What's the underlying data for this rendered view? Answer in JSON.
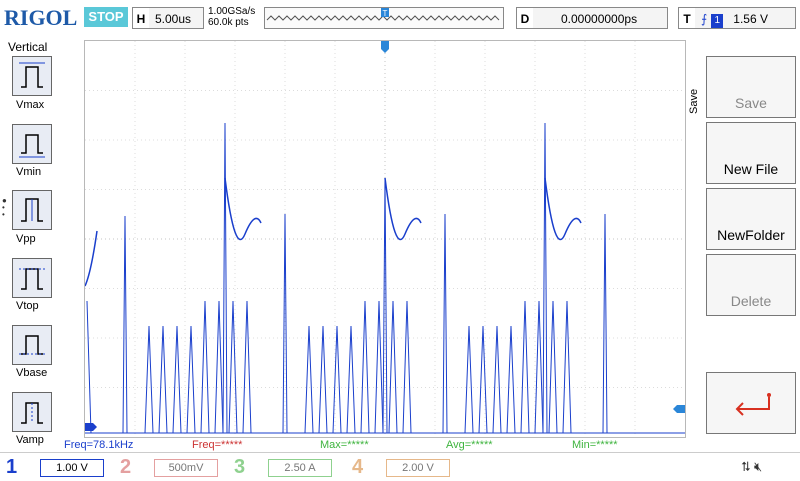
{
  "header": {
    "brand": "RIGOL",
    "run_state": "STOP",
    "horizontal_tag": "H",
    "timebase": "5.00us",
    "sample_rate": "1.00GSa/s",
    "memory_depth": "60.0k pts",
    "trigger_marker": "T",
    "delay_tag": "D",
    "delay_value": "0.00000000ps",
    "trigger_tag": "T",
    "trigger_channel": "1",
    "trigger_level": "1.56 V"
  },
  "left_panel": {
    "title": "Vertical",
    "items": [
      {
        "label": "Vmax",
        "icon": "vmax-waveform-icon"
      },
      {
        "label": "Vmin",
        "icon": "vmin-waveform-icon"
      },
      {
        "label": "Vpp",
        "icon": "vpp-waveform-icon"
      },
      {
        "label": "Vtop",
        "icon": "vtop-waveform-icon"
      },
      {
        "label": "Vbase",
        "icon": "vbase-waveform-icon"
      },
      {
        "label": "Vamp",
        "icon": "vamp-waveform-icon"
      }
    ]
  },
  "right_panel": {
    "title": "Save",
    "save_label": "Save",
    "new_file_label": "New File",
    "new_folder_label": "NewFolder",
    "delete_label": "Delete",
    "back_icon": "return-arrow-icon"
  },
  "measurements": {
    "freq_ch1": "Freq=78.1kHz",
    "freq_2": "Freq=*****",
    "max": "Max=*****",
    "avg": "Avg=*****",
    "min": "Min=*****"
  },
  "channels": [
    {
      "num": "1",
      "scale": "1.00 V"
    },
    {
      "num": "2",
      "scale": "500mV"
    },
    {
      "num": "3",
      "scale": "2.50 A"
    },
    {
      "num": "4",
      "scale": "2.00 V"
    }
  ],
  "status_icons": [
    "usb-icon",
    "speaker-muted-icon"
  ],
  "colors": {
    "brand": "#1e5aa8",
    "stop": "#5ac8d8",
    "ch1": "#1a3fcc",
    "ch2": "#e4a0a0",
    "ch3": "#8fd18f",
    "ch4": "#e6b88a",
    "freq2": "#cc3333",
    "max": "#3fb43f",
    "avg": "#3fb43f",
    "min": "#3fb43f"
  }
}
